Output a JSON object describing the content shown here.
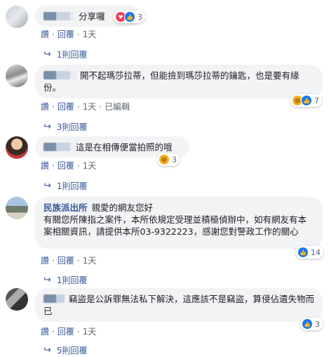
{
  "comments": [
    {
      "author": "",
      "text": "分享囉",
      "reactions": {
        "count": "3",
        "icons": [
          "love",
          "like"
        ]
      },
      "actions": {
        "like": "讚",
        "reply": "回覆",
        "time": "1天",
        "edited": ""
      },
      "replies": "1則回覆"
    },
    {
      "author": "",
      "text": "開不起瑪莎拉蒂，但能撿到瑪莎拉蒂的鑰匙，也是要有緣份。",
      "reactions": {
        "count": "7",
        "icons": [
          "haha",
          "like"
        ]
      },
      "actions": {
        "like": "讚",
        "reply": "回覆",
        "time": "1天",
        "edited": "已編輯"
      },
      "replies": "3則回覆"
    },
    {
      "author": "",
      "text": "這是在相傳便當拍照的哦",
      "reactions": {
        "count": "3",
        "icons": [
          "haha"
        ]
      },
      "actions": {
        "like": "讚",
        "reply": "回覆",
        "time": "1天",
        "edited": ""
      },
      "replies": "1則回覆"
    },
    {
      "author": "民族派出所",
      "text_line1": "親愛的網友您好",
      "text": "有關您所陳指之案件，本所依規定受理並積極偵辦中，如有網友有本案相關資訊，請提供本所03-9322223，感謝您對警政工作的關心",
      "reactions": {
        "count": "14",
        "icons": [
          "like"
        ]
      },
      "actions": {
        "like": "讚",
        "reply": "回覆",
        "time": "1天",
        "edited": ""
      },
      "replies": "1則回覆"
    },
    {
      "author": "",
      "text": "竊盜是公訴罪無法私下解決，這應該不是竊盜，算侵佔遺失物而已",
      "reactions": {
        "count": "3",
        "icons": [
          "like"
        ]
      },
      "actions": {
        "like": "讚",
        "reply": "回覆",
        "time": "1天",
        "edited": ""
      },
      "replies": "5則回覆"
    }
  ],
  "colors": {
    "link": "#385898",
    "bubble": "#f2f3f5",
    "like": "#1877f2"
  }
}
